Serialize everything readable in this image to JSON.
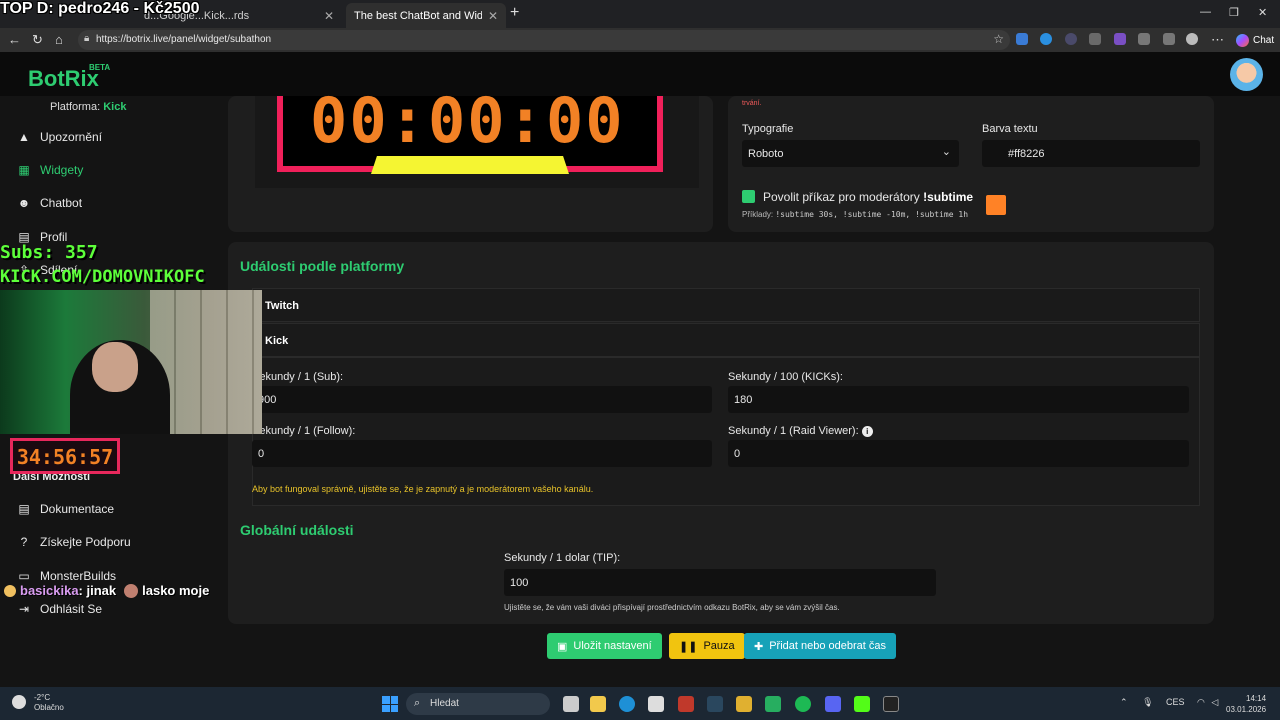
{
  "browser": {
    "tabs": [
      {
        "label": "d...Google...Kick...rds"
      },
      {
        "label": "The best ChatBot and Widgets for"
      }
    ],
    "url": "https://botrix.live/panel/widget/subathon",
    "chat_label": "Chat"
  },
  "app": {
    "logo": "BotRix",
    "beta": "BETA",
    "platform_prefix": "Platforma:",
    "platform_value": "Kick"
  },
  "sidebar": {
    "items": [
      {
        "label": "Upozornění",
        "icon": "warning-icon"
      },
      {
        "label": "Widgety",
        "icon": "grid-icon"
      },
      {
        "label": "Chatbot",
        "icon": "robot-icon"
      },
      {
        "label": "Profil",
        "icon": "id-card-icon"
      },
      {
        "label": "Sdílení",
        "icon": "share-icon"
      }
    ],
    "more_label": "Další Možnosti",
    "more_items": [
      {
        "label": "Dokumentace",
        "icon": "document-icon"
      },
      {
        "label": "Získejte Podporu",
        "icon": "help-icon"
      },
      {
        "label": "MonsterBuilds",
        "icon": "laptop-icon"
      },
      {
        "label": "Odhlásit Se",
        "icon": "logout-icon"
      }
    ]
  },
  "preview": {
    "timer": "00:00:00"
  },
  "settings": {
    "trvani_text": "trvání.",
    "typography_label": "Typografie",
    "typography_value": "Roboto",
    "text_color_label": "Barva textu",
    "text_color_value": "#ff8226",
    "mod_command_label": "Povolit příkaz pro moderátory",
    "mod_command_cmd": "!subtime",
    "examples_prefix": "Příklady:",
    "examples": "!subtime 30s, !subtime -10m, !subtime 1h"
  },
  "platform_events": {
    "title": "Události podle platformy",
    "accordions": [
      "Twitch",
      "Kick"
    ],
    "fields": [
      {
        "label": "Sekundy / 1 (Sub):",
        "value": "900"
      },
      {
        "label": "Sekundy / 100 (KICKs):",
        "value": "180"
      },
      {
        "label": "Sekundy / 1 (Follow):",
        "value": "0"
      },
      {
        "label": "Sekundy / 1 (Raid Viewer):",
        "value": "0"
      }
    ],
    "warning": "Aby bot fungoval správně, ujistěte se, že je zapnutý a je moderátorem vašeho kanálu."
  },
  "global_events": {
    "title": "Globální události",
    "tip_label": "Sekundy / 1 dolar (TIP):",
    "tip_value": "100",
    "tip_note": "Ujistěte se, že vám vaši diváci přispívají prostřednictvím odkazu BotRix, aby se vám zvýšil čas."
  },
  "actions": {
    "save": "Uložit nastavení",
    "pause": "Pauza",
    "add_time": "Přidat nebo odebrat čas"
  },
  "overlay": {
    "top_text": "TOP D: pedro246 - Kč2500",
    "subs": "Subs: 357",
    "kick_url": "KICK.COM/DOMOVNIKOFC",
    "countdown": "34:56:57",
    "chat_user": "basickika",
    "chat_msg": ": jinak",
    "chat_msg2": "lasko moje"
  },
  "taskbar": {
    "temp": "-2°C",
    "weather": "Oblačno",
    "search": "Hledat",
    "lang": "CES",
    "time": "14:14",
    "date": "03.01.2026"
  },
  "colors": {
    "accent": "#2ecc71",
    "timer_orange": "#f28125",
    "timer_frame": "#f0205a",
    "timer_bar": "#f5f532",
    "save_btn": "#2ecc71",
    "pause_btn": "#f1c40f",
    "add_btn": "#17a2b8"
  }
}
